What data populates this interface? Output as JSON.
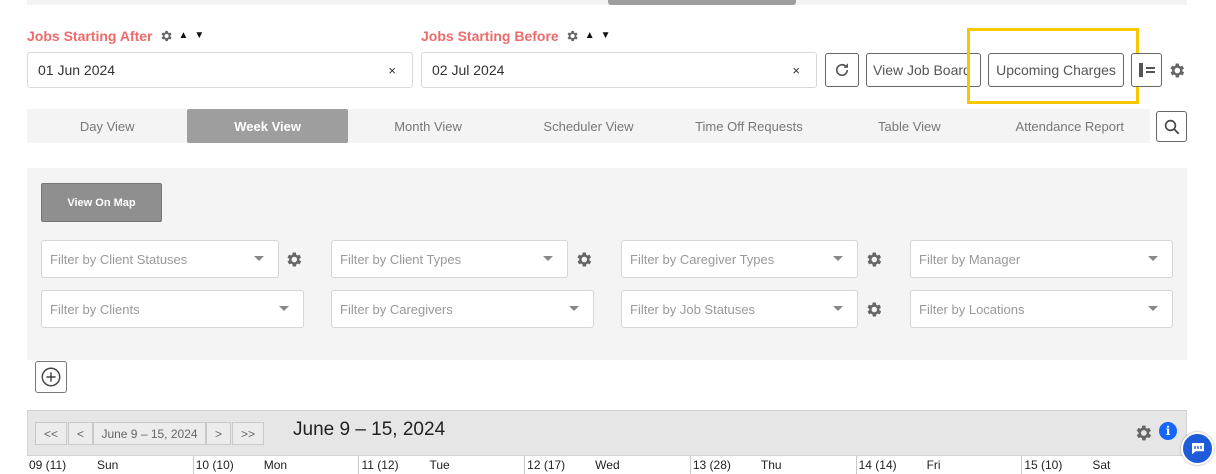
{
  "filters": {
    "after": {
      "label": "Jobs Starting After",
      "value": "01 Jun 2024",
      "clear": "×"
    },
    "before": {
      "label": "Jobs Starting Before",
      "value": "02 Jul 2024",
      "clear": "×"
    }
  },
  "toolbar": {
    "view_job_board": "View Job Board",
    "upcoming_charges": "Upcoming Charges"
  },
  "view_tabs": [
    {
      "label": "Day View",
      "active": false
    },
    {
      "label": "Week View",
      "active": true
    },
    {
      "label": "Month View",
      "active": false
    },
    {
      "label": "Scheduler View",
      "active": false
    },
    {
      "label": "Time Off Requests",
      "active": false
    },
    {
      "label": "Table View",
      "active": false
    },
    {
      "label": "Attendance Report",
      "active": false
    }
  ],
  "filter_panel": {
    "map_button": "View On Map",
    "selects": [
      {
        "placeholder": "Filter by Client Statuses"
      },
      {
        "placeholder": "Filter by Client Types"
      },
      {
        "placeholder": "Filter by Caregiver Types"
      },
      {
        "placeholder": "Filter by Manager"
      },
      {
        "placeholder": "Filter by Clients"
      },
      {
        "placeholder": "Filter by Caregivers"
      },
      {
        "placeholder": "Filter by Job Statuses"
      },
      {
        "placeholder": "Filter by Locations"
      }
    ]
  },
  "calendar": {
    "nav": {
      "first": "<<",
      "prev": "<",
      "range": "June 9 – 15, 2024",
      "next": ">",
      "last": ">>"
    },
    "title": "June 9 – 15, 2024",
    "info": "i",
    "days": [
      {
        "num": "09 (11)",
        "name": "Sun"
      },
      {
        "num": "10 (10)",
        "name": "Mon"
      },
      {
        "num": "11 (12)",
        "name": "Tue"
      },
      {
        "num": "12 (17)",
        "name": "Wed"
      },
      {
        "num": "13 (28)",
        "name": "Thu"
      },
      {
        "num": "14 (14)",
        "name": "Fri"
      },
      {
        "num": "15 (10)",
        "name": "Sat"
      }
    ]
  },
  "colors": {
    "accent_label": "#ef6a6a",
    "highlight": "#f5c800",
    "info": "#1565ff"
  }
}
